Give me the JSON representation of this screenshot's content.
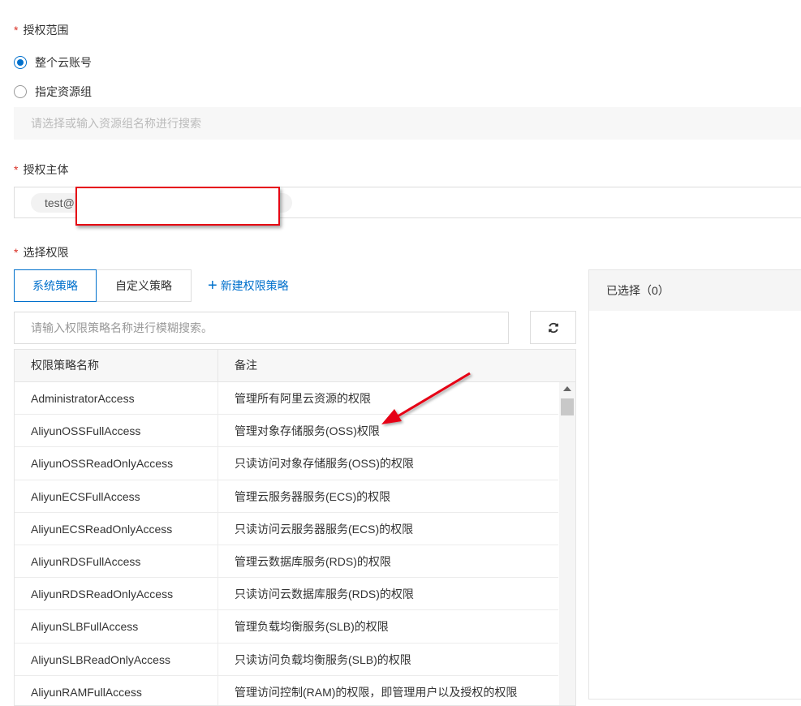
{
  "scope": {
    "label": "授权范围",
    "options": [
      {
        "label": "整个云账号",
        "checked": true
      },
      {
        "label": "指定资源组",
        "checked": false
      }
    ],
    "resource_group_placeholder": "请选择或输入资源组名称进行搜索"
  },
  "principal": {
    "label": "授权主体",
    "tag_text": "test@"
  },
  "permissions": {
    "label": "选择权限",
    "tabs": [
      {
        "label": "系统策略",
        "active": true
      },
      {
        "label": "自定义策略",
        "active": false
      }
    ],
    "new_policy_label": "新建权限策略",
    "search_placeholder": "请输入权限策略名称进行模糊搜索。",
    "refresh_icon": "refresh-icon",
    "columns": [
      "权限策略名称",
      "备注"
    ],
    "rows": [
      {
        "name": "AdministratorAccess",
        "note": "管理所有阿里云资源的权限"
      },
      {
        "name": "AliyunOSSFullAccess",
        "note": "管理对象存储服务(OSS)权限"
      },
      {
        "name": "AliyunOSSReadOnlyAccess",
        "note": "只读访问对象存储服务(OSS)的权限"
      },
      {
        "name": "AliyunECSFullAccess",
        "note": "管理云服务器服务(ECS)的权限"
      },
      {
        "name": "AliyunECSReadOnlyAccess",
        "note": "只读访问云服务器服务(ECS)的权限"
      },
      {
        "name": "AliyunRDSFullAccess",
        "note": "管理云数据库服务(RDS)的权限"
      },
      {
        "name": "AliyunRDSReadOnlyAccess",
        "note": "只读访问云数据库服务(RDS)的权限"
      },
      {
        "name": "AliyunSLBFullAccess",
        "note": "管理负载均衡服务(SLB)的权限"
      },
      {
        "name": "AliyunSLBReadOnlyAccess",
        "note": "只读访问负载均衡服务(SLB)的权限"
      },
      {
        "name": "AliyunRAMFullAccess",
        "note": "管理访问控制(RAM)的权限，即管理用户以及授权的权限"
      }
    ]
  },
  "selected": {
    "label": "已选择（0）"
  },
  "colors": {
    "accent": "#0070cc",
    "required": "#d93026",
    "annotation": "#e60012"
  }
}
